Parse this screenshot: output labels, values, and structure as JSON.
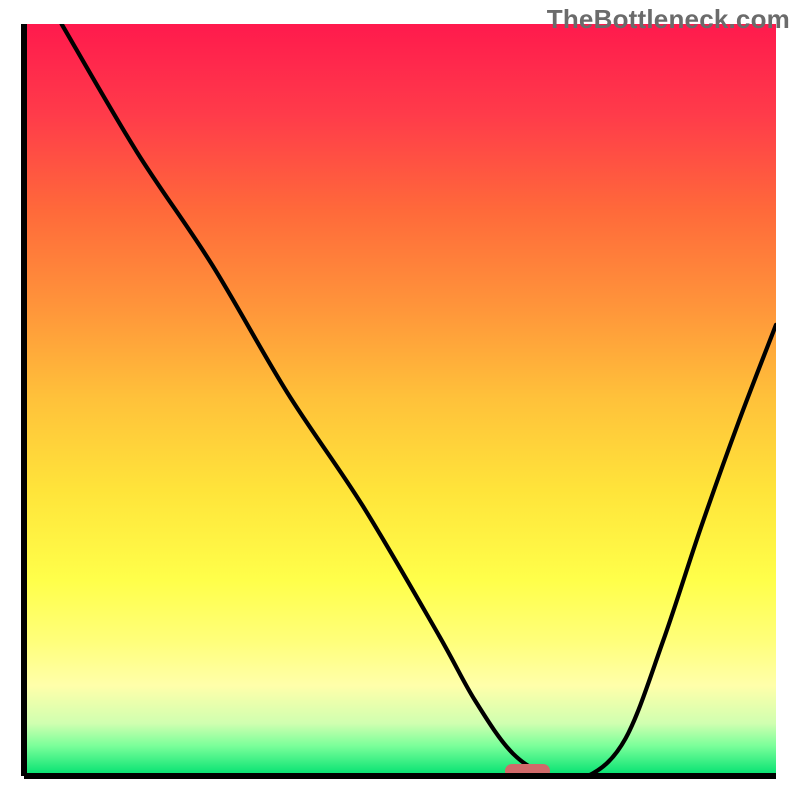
{
  "watermark": "TheBottleneck.com",
  "chart_data": {
    "type": "line",
    "title": "",
    "xlabel": "",
    "ylabel": "",
    "xlim": [
      0,
      100
    ],
    "ylim": [
      0,
      100
    ],
    "background": "gradient_red_to_green",
    "series": [
      {
        "name": "curve",
        "x": [
          5,
          15,
          25,
          35,
          45,
          55,
          60,
          65,
          70,
          75,
          80,
          85,
          90,
          95,
          100
        ],
        "y": [
          100,
          83,
          68,
          51,
          36,
          19,
          10,
          3,
          0,
          0,
          5,
          18,
          33,
          47,
          60
        ]
      }
    ],
    "marker": {
      "x_center": 67,
      "y": 0,
      "width": 6
    },
    "colors": {
      "curve": "#000000",
      "marker": "#d16a6a",
      "axis": "#000000"
    }
  }
}
